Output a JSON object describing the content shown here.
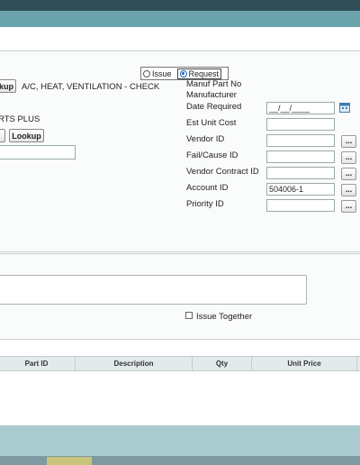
{
  "issue_type": {
    "options": [
      "Issue",
      "Request"
    ],
    "selected": "Request"
  },
  "lookup_button_partial": "kup",
  "work_description": "A/C, HEAT, VENTILATION - CHECK",
  "vendor_name_partial": "RTS PLUS",
  "lookup_button": "Lookup",
  "right_fields": {
    "manuf_part_no_label": "Manuf Part No",
    "manufacturer_label": "Manufacturer",
    "date_required_label": "Date Required",
    "date_required_value": "__/__/____",
    "est_unit_cost_label": "Est Unit Cost",
    "vendor_id_label": "Vendor ID",
    "fail_cause_id_label": "Fail/Cause ID",
    "vendor_contract_id_label": "Vendor Contract ID",
    "account_id_label": "Account ID",
    "account_id_value": "504006-1",
    "priority_id_label": "Priority ID",
    "ellipsis": "..."
  },
  "issue_together_label": "Issue Together",
  "grid": {
    "columns": [
      "Part ID",
      "Description",
      "Qty",
      "Unit Price"
    ]
  },
  "colors": {
    "topbar": "#2f4e57",
    "titlebar": "#6aa3ab",
    "footer": "#a9cbd0"
  }
}
